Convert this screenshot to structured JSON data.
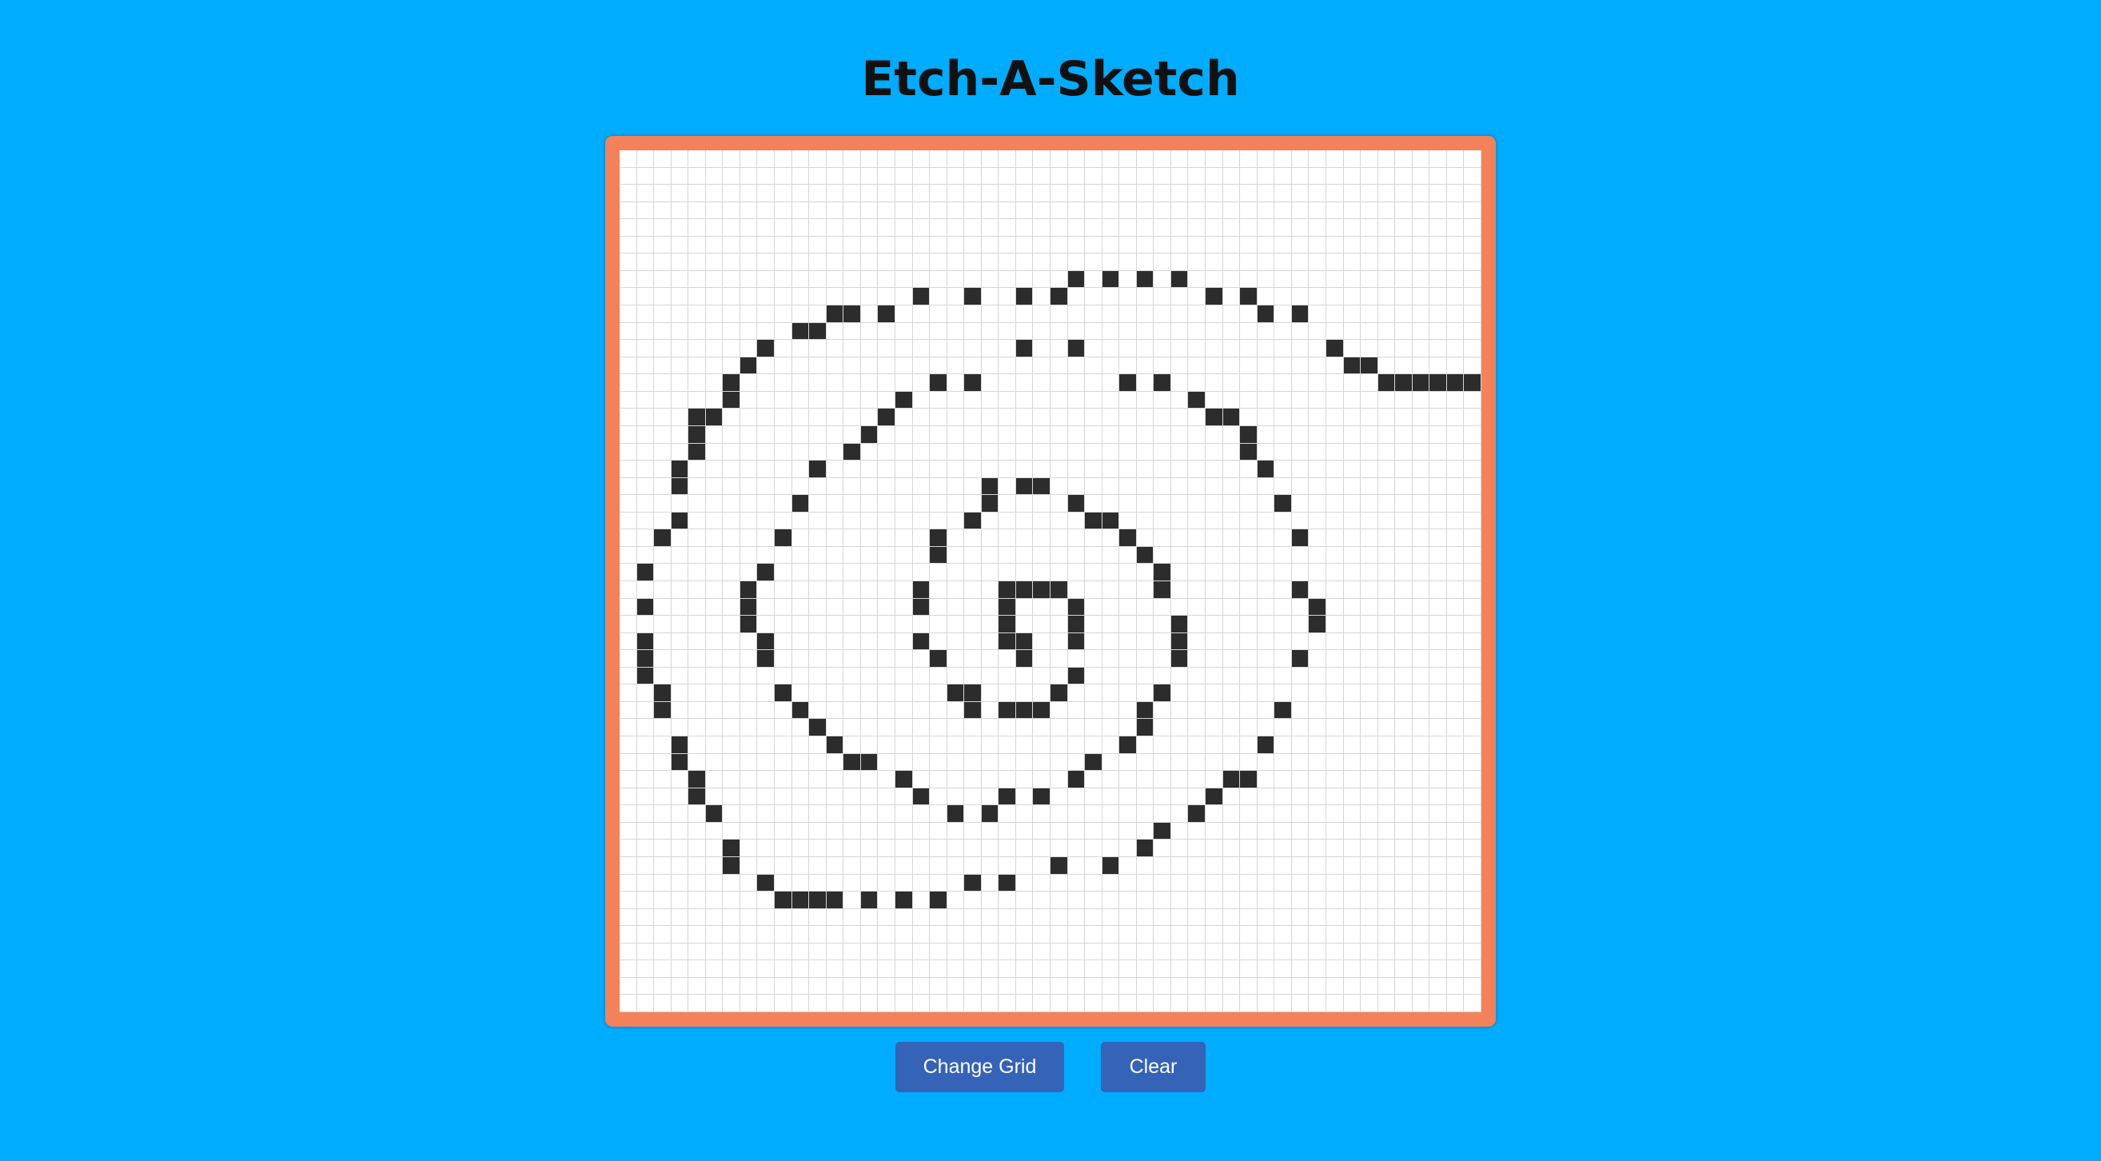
{
  "app": {
    "title": "Etch-A-Sketch"
  },
  "grid": {
    "size": 50,
    "ink_color": "#2c2c2c",
    "background_color": "#ffffff",
    "line_color": "#d6d6d6",
    "filled": [
      [
        7,
        26
      ],
      [
        7,
        28
      ],
      [
        7,
        30
      ],
      [
        7,
        32
      ],
      [
        8,
        17
      ],
      [
        8,
        20
      ],
      [
        8,
        23
      ],
      [
        8,
        25
      ],
      [
        8,
        34
      ],
      [
        8,
        36
      ],
      [
        9,
        12
      ],
      [
        9,
        13
      ],
      [
        9,
        15
      ],
      [
        9,
        37
      ],
      [
        9,
        39
      ],
      [
        10,
        10
      ],
      [
        10,
        11
      ],
      [
        11,
        8
      ],
      [
        11,
        23
      ],
      [
        11,
        26
      ],
      [
        11,
        41
      ],
      [
        12,
        7
      ],
      [
        12,
        42
      ],
      [
        12,
        43
      ],
      [
        13,
        6
      ],
      [
        13,
        18
      ],
      [
        13,
        20
      ],
      [
        13,
        29
      ],
      [
        13,
        31
      ],
      [
        13,
        44
      ],
      [
        13,
        45
      ],
      [
        13,
        46
      ],
      [
        13,
        47
      ],
      [
        13,
        48
      ],
      [
        13,
        49
      ],
      [
        14,
        6
      ],
      [
        14,
        16
      ],
      [
        14,
        33
      ],
      [
        15,
        4
      ],
      [
        15,
        5
      ],
      [
        15,
        15
      ],
      [
        15,
        34
      ],
      [
        15,
        35
      ],
      [
        16,
        4
      ],
      [
        16,
        14
      ],
      [
        16,
        36
      ],
      [
        17,
        4
      ],
      [
        17,
        13
      ],
      [
        17,
        36
      ],
      [
        18,
        3
      ],
      [
        18,
        11
      ],
      [
        18,
        37
      ],
      [
        19,
        3
      ],
      [
        19,
        21
      ],
      [
        19,
        23
      ],
      [
        19,
        24
      ],
      [
        20,
        10
      ],
      [
        20,
        21
      ],
      [
        20,
        26
      ],
      [
        20,
        38
      ],
      [
        21,
        3
      ],
      [
        21,
        20
      ],
      [
        21,
        27
      ],
      [
        21,
        28
      ],
      [
        22,
        2
      ],
      [
        22,
        9
      ],
      [
        22,
        18
      ],
      [
        22,
        29
      ],
      [
        22,
        39
      ],
      [
        23,
        18
      ],
      [
        23,
        30
      ],
      [
        24,
        1
      ],
      [
        24,
        8
      ],
      [
        24,
        31
      ],
      [
        25,
        7
      ],
      [
        25,
        17
      ],
      [
        25,
        22
      ],
      [
        25,
        23
      ],
      [
        25,
        24
      ],
      [
        25,
        25
      ],
      [
        25,
        31
      ],
      [
        25,
        39
      ],
      [
        26,
        1
      ],
      [
        26,
        7
      ],
      [
        26,
        17
      ],
      [
        26,
        22
      ],
      [
        26,
        26
      ],
      [
        26,
        40
      ],
      [
        27,
        7
      ],
      [
        27,
        22
      ],
      [
        27,
        26
      ],
      [
        27,
        32
      ],
      [
        27,
        40
      ],
      [
        28,
        1
      ],
      [
        28,
        8
      ],
      [
        28,
        17
      ],
      [
        28,
        22
      ],
      [
        28,
        23
      ],
      [
        28,
        26
      ],
      [
        28,
        32
      ],
      [
        29,
        1
      ],
      [
        29,
        8
      ],
      [
        29,
        18
      ],
      [
        29,
        23
      ],
      [
        29,
        32
      ],
      [
        29,
        39
      ],
      [
        30,
        1
      ],
      [
        30,
        26
      ],
      [
        31,
        2
      ],
      [
        31,
        9
      ],
      [
        31,
        19
      ],
      [
        31,
        20
      ],
      [
        31,
        25
      ],
      [
        31,
        31
      ],
      [
        32,
        2
      ],
      [
        32,
        10
      ],
      [
        32,
        20
      ],
      [
        32,
        22
      ],
      [
        32,
        23
      ],
      [
        32,
        24
      ],
      [
        32,
        30
      ],
      [
        32,
        38
      ],
      [
        33,
        11
      ],
      [
        33,
        30
      ],
      [
        34,
        3
      ],
      [
        34,
        12
      ],
      [
        34,
        29
      ],
      [
        34,
        37
      ],
      [
        35,
        3
      ],
      [
        35,
        13
      ],
      [
        35,
        14
      ],
      [
        35,
        27
      ],
      [
        36,
        4
      ],
      [
        36,
        16
      ],
      [
        36,
        26
      ],
      [
        36,
        35
      ],
      [
        36,
        36
      ],
      [
        37,
        4
      ],
      [
        37,
        17
      ],
      [
        37,
        22
      ],
      [
        37,
        24
      ],
      [
        37,
        34
      ],
      [
        38,
        5
      ],
      [
        38,
        19
      ],
      [
        38,
        21
      ],
      [
        38,
        33
      ],
      [
        39,
        31
      ],
      [
        40,
        6
      ],
      [
        40,
        30
      ],
      [
        41,
        6
      ],
      [
        41,
        25
      ],
      [
        41,
        28
      ],
      [
        42,
        8
      ],
      [
        42,
        20
      ],
      [
        42,
        22
      ],
      [
        43,
        9
      ],
      [
        43,
        10
      ],
      [
        43,
        11
      ],
      [
        43,
        12
      ],
      [
        43,
        14
      ],
      [
        43,
        16
      ],
      [
        43,
        18
      ]
    ]
  },
  "controls": {
    "change_grid_label": "Change Grid",
    "clear_label": "Clear"
  }
}
